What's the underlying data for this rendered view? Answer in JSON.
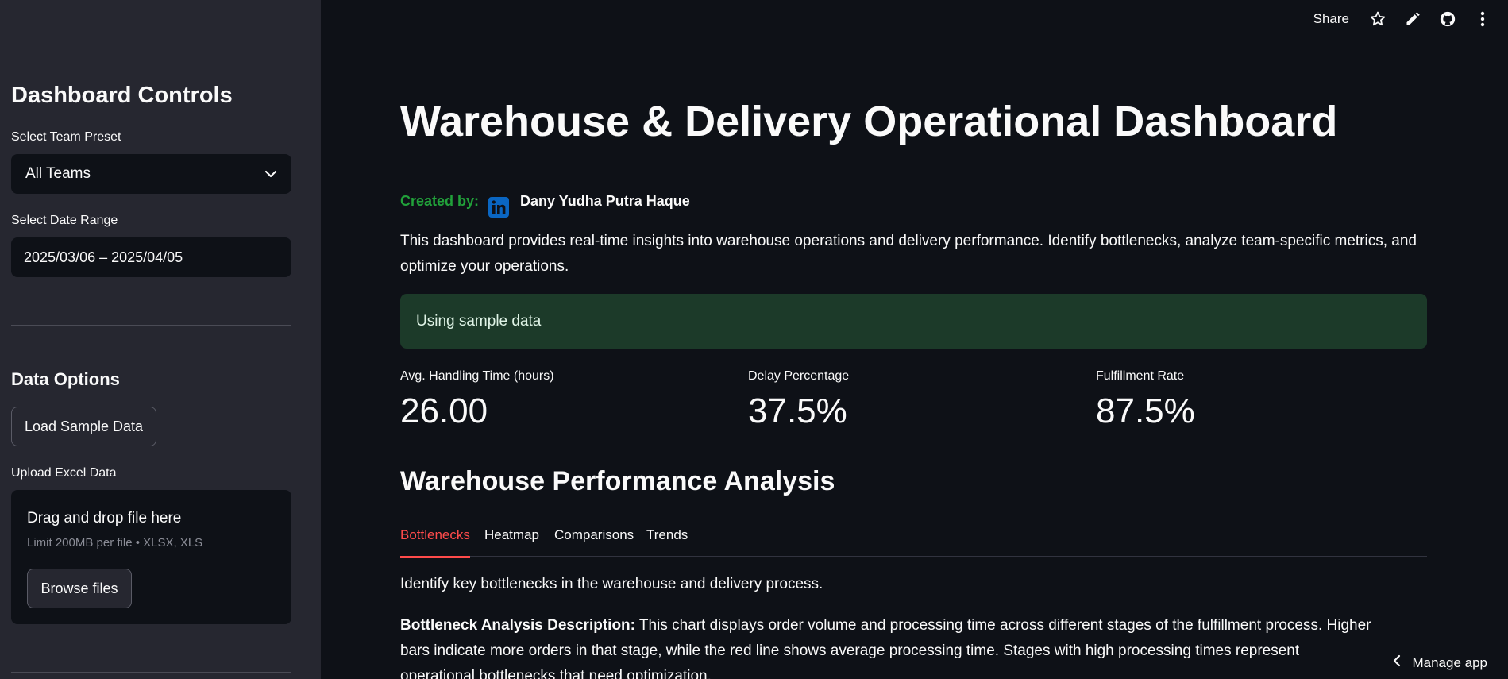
{
  "sidebar": {
    "title": "Dashboard Controls",
    "team_preset": {
      "label": "Select Team Preset",
      "value": "All Teams"
    },
    "date_range": {
      "label": "Select Date Range",
      "value": "2025/03/06 – 2025/04/05"
    },
    "data_options": {
      "title": "Data Options",
      "load_sample_button": "Load Sample Data",
      "upload_label": "Upload Excel Data",
      "dropzone_text": "Drag and drop file here",
      "dropzone_limit": "Limit 200MB per file • XLSX, XLS",
      "browse_button": "Browse files"
    }
  },
  "topbar": {
    "share_label": "Share"
  },
  "main": {
    "title": "Warehouse & Delivery Operational Dashboard",
    "created_by_label": "Created by:",
    "author": "Dany Yudha Putra Haque",
    "description": "This dashboard provides real-time insights into warehouse operations and delivery performance. Identify bottlenecks, analyze team-specific metrics, and optimize your operations.",
    "info_message": "Using sample data",
    "metrics": [
      {
        "label": "Avg. Handling Time (hours)",
        "value": "26.00"
      },
      {
        "label": "Delay Percentage",
        "value": "37.5%"
      },
      {
        "label": "Fulfillment Rate",
        "value": "87.5%"
      }
    ],
    "section_title": "Warehouse Performance Analysis",
    "tabs": [
      {
        "label": "Bottlenecks",
        "active": true
      },
      {
        "label": "Heatmap",
        "active": false
      },
      {
        "label": "Comparisons",
        "active": false
      },
      {
        "label": "Trends",
        "active": false
      }
    ],
    "tab_intro": "Identify key bottlenecks in the warehouse and delivery process.",
    "analysis_heading": "Bottleneck Analysis Description:",
    "analysis_text": " This chart displays order volume and processing time across different stages of the fulfillment process. Higher bars indicate more orders in that stage, while the red line shows average processing time. Stages with high processing times represent operational bottlenecks that need optimization."
  },
  "manage_app": {
    "label": "Manage app"
  },
  "colors": {
    "background": "#0e1117",
    "sidebar": "#262730",
    "accent_red": "#ff4b4b",
    "created_by_green": "#21a13a",
    "info_bg": "#1c3a29",
    "linkedin_blue": "#0a66c2"
  }
}
